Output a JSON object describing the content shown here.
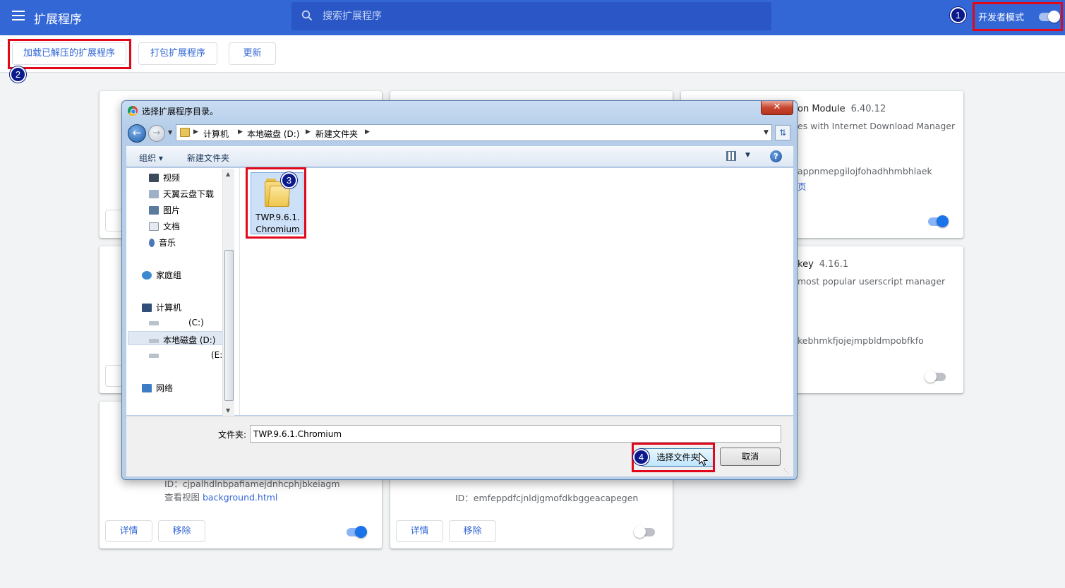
{
  "header": {
    "title": "扩展程序",
    "search_placeholder": "搜索扩展程序",
    "dev_mode_label": "开发者模式"
  },
  "actions": {
    "load_unpacked": "加载已解压的扩展程序",
    "pack": "打包扩展程序",
    "update": "更新"
  },
  "steps": [
    "1",
    "2",
    "3",
    "4"
  ],
  "cards": {
    "c1": {
      "name": "on Module",
      "version": "6.40.12",
      "desc": "es with Internet Download Manager",
      "id": "appnmepgilojfohadhhmbhlaek",
      "link": "页",
      "enabled": true
    },
    "c2": {
      "name": "key",
      "version": "4.16.1",
      "desc": "most popular userscript manager",
      "id": "kebhmkfjojejmpbldmpobfkfo",
      "enabled": false
    },
    "c3": {
      "id": "ID：cjpalhdlnbpafiamejdnhcphjbkeiagm",
      "view_label": "查看视图",
      "view_link": "background.html",
      "details": "详情",
      "remove": "移除",
      "enabled": true
    },
    "c4": {
      "id": "ID：emfeppdfcjnldjgmofdkbggeacapegen",
      "details": "详情",
      "remove": "移除",
      "enabled": false
    }
  },
  "dialog": {
    "title": "选择扩展程序目录。",
    "close": "✕",
    "breadcrumb": [
      "计算机",
      "本地磁盘 (D:)",
      "新建文件夹"
    ],
    "organize": "组织 ▾",
    "new_folder": "新建文件夹",
    "help": "?",
    "nav": {
      "videos": "视频",
      "tianyi": "天翼云盘下载",
      "pictures": "图片",
      "documents": "文档",
      "music": "音乐",
      "homegroup": "家庭组",
      "computer": "计算机",
      "drive_c": "(C:)",
      "drive_d": "本地磁盘 (D:)",
      "drive_e": "(E:)",
      "network": "网络"
    },
    "file_line1": "TWP.9.6.1.",
    "file_line2": "Chromium",
    "folder_label": "文件夹:",
    "folder_value": "TWP.9.6.1.Chromium",
    "select_button": "选择文件夹",
    "cancel_button": "取消"
  }
}
